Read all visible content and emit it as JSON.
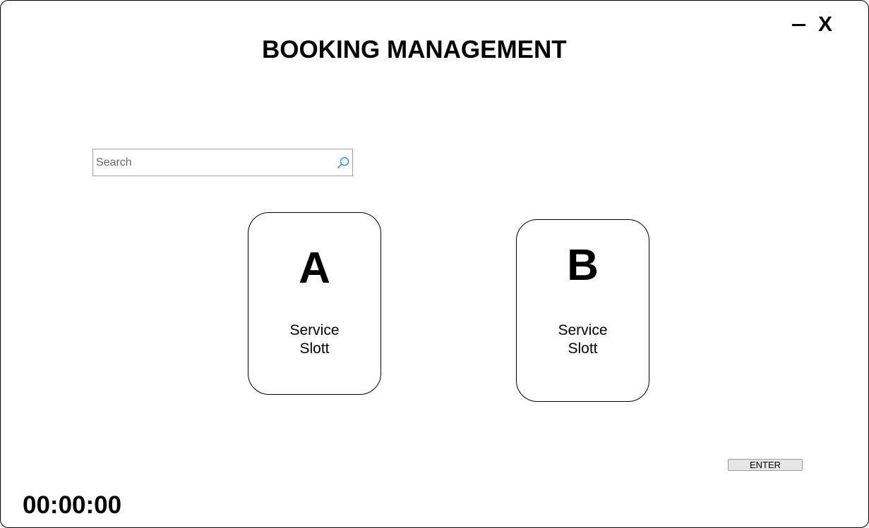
{
  "header": {
    "title": "BOOKING MANAGEMENT",
    "minimize_label": "–",
    "close_label": "X"
  },
  "search": {
    "placeholder": "Search",
    "value": "",
    "icon": "search-icon"
  },
  "slots": [
    {
      "letter": "A",
      "line1": "Service",
      "line2": "Slott"
    },
    {
      "letter": "B",
      "line1": "Service",
      "line2": "Slott"
    }
  ],
  "actions": {
    "enter_label": "ENTER"
  },
  "timer": {
    "value": "00:00:00"
  },
  "colors": {
    "search_icon": "#2b8fd6",
    "border": "#000000",
    "button_bg": "#e6e6e6"
  }
}
